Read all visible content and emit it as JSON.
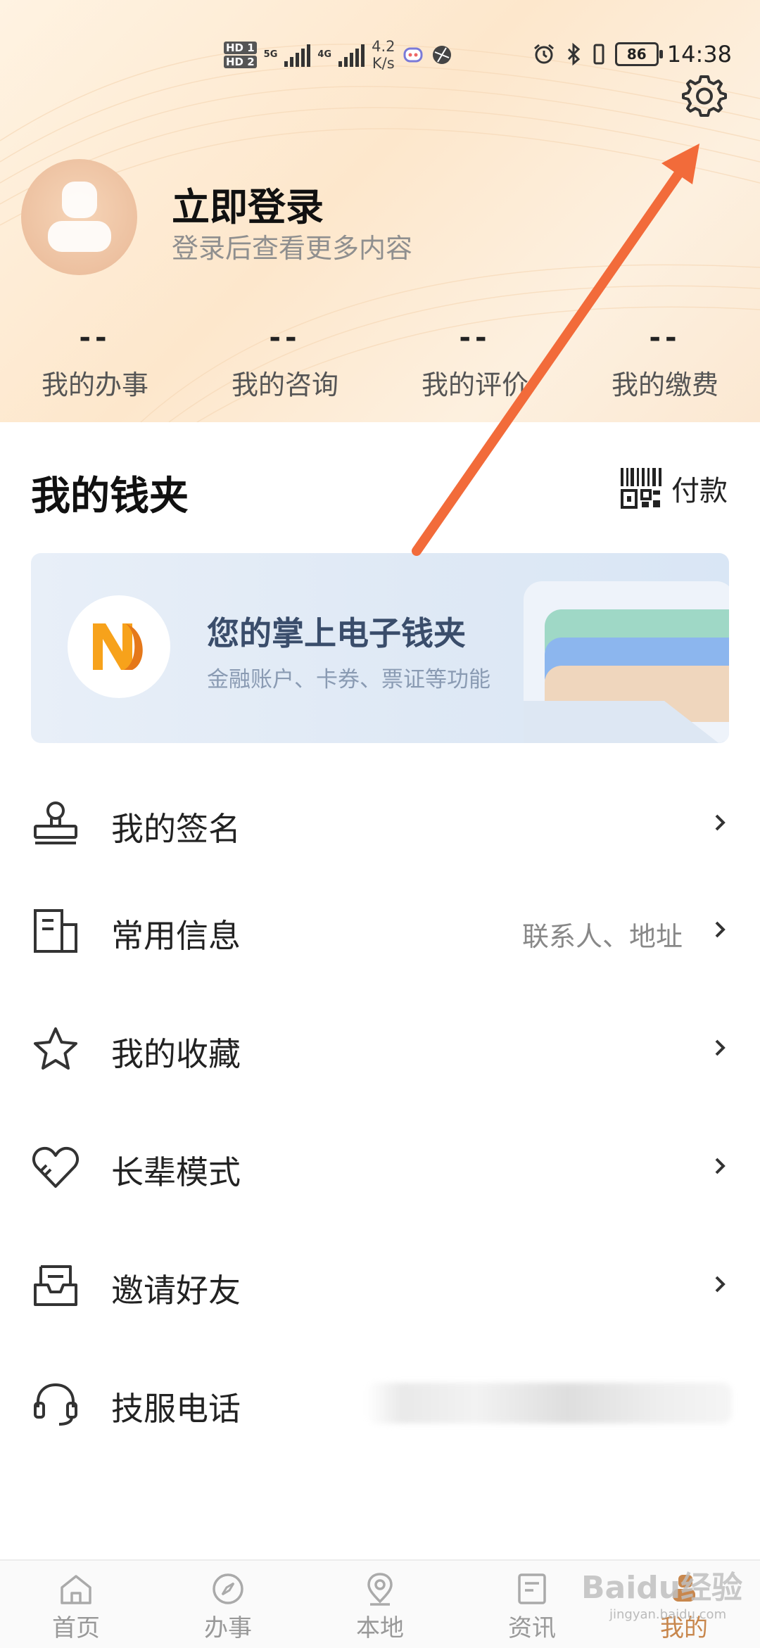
{
  "status_bar": {
    "hd1": "HD 1",
    "hd2": "HD 2",
    "net1": "5G",
    "net2": "4G",
    "speed_value": "4.2",
    "speed_unit": "K/s",
    "battery": "86",
    "time": "14:38"
  },
  "profile": {
    "login_title": "立即登录",
    "login_subtitle": "登录后查看更多内容"
  },
  "stats": [
    {
      "value": "--",
      "label": "我的办事"
    },
    {
      "value": "--",
      "label": "我的咨询"
    },
    {
      "value": "--",
      "label": "我的评价"
    },
    {
      "value": "--",
      "label": "我的缴费"
    }
  ],
  "wallet": {
    "title": "我的钱夹",
    "pay_label": "付款",
    "card_title": "您的掌上电子钱夹",
    "card_subtitle": "金融账户、卡券、票证等功能"
  },
  "menu": [
    {
      "label": "我的签名",
      "hint": "",
      "icon": "stamp-icon"
    },
    {
      "label": "常用信息",
      "hint": "联系人、地址",
      "icon": "building-icon"
    },
    {
      "label": "我的收藏",
      "hint": "",
      "icon": "star-icon"
    },
    {
      "label": "长辈模式",
      "hint": "",
      "icon": "heart-icon"
    },
    {
      "label": "邀请好友",
      "hint": "",
      "icon": "inbox-icon"
    },
    {
      "label": "技服电话",
      "hint": "",
      "icon": "headset-icon"
    }
  ],
  "bottom_nav": [
    {
      "label": "首页",
      "icon": "home-icon"
    },
    {
      "label": "办事",
      "icon": "compass-icon"
    },
    {
      "label": "本地",
      "icon": "location-icon"
    },
    {
      "label": "资讯",
      "icon": "news-icon"
    },
    {
      "label": "我的",
      "icon": "profile-icon",
      "active": true
    }
  ],
  "watermark": {
    "text": "Baidu经验",
    "url": "jingyan.baidu.com"
  },
  "colors": {
    "accent": "#c8874d",
    "arrow": "#f26b3a",
    "header_bg": "#fde7cc"
  }
}
